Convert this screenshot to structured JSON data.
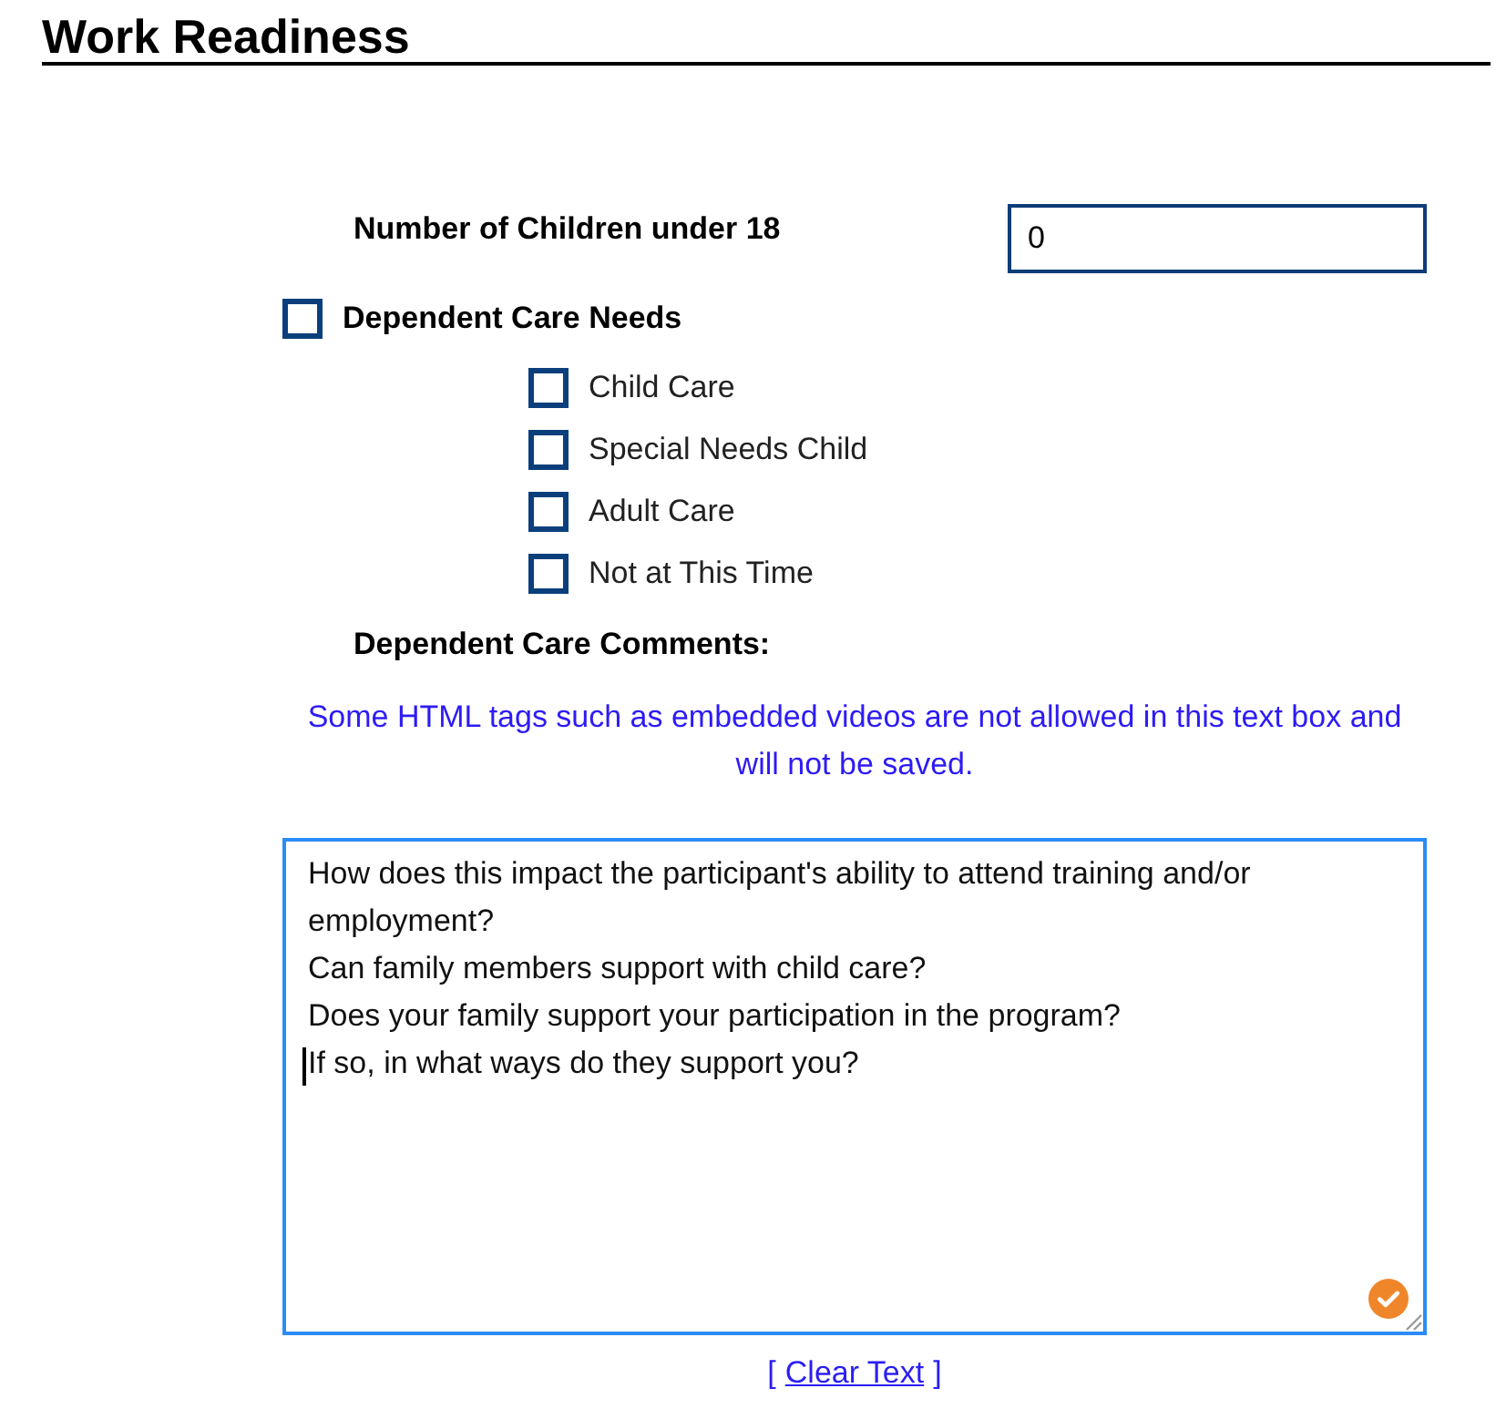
{
  "heading": {
    "title": "Work Readiness"
  },
  "children_count": {
    "label": "Number of Children under 18",
    "value": "0"
  },
  "dependent_care": {
    "label": "Dependent Care Needs",
    "checked": false,
    "options": [
      {
        "label": "Child Care",
        "checked": false
      },
      {
        "label": "Special Needs Child",
        "checked": false
      },
      {
        "label": "Adult Care",
        "checked": false
      },
      {
        "label": "Not at This Time",
        "checked": false
      }
    ]
  },
  "comments": {
    "label": "Dependent Care Comments:",
    "notice": "Some HTML tags such as embedded videos are not allowed in this text box and will not be saved.",
    "value": "How does this impact the participant's ability to attend training and/or employment?\nCan family members support with child care?\nDoes your family support your participation in the program?\nIf so, in what ways do they support you?",
    "clear_link": {
      "open": "[",
      "label": "Clear Text",
      "close": "]"
    }
  }
}
